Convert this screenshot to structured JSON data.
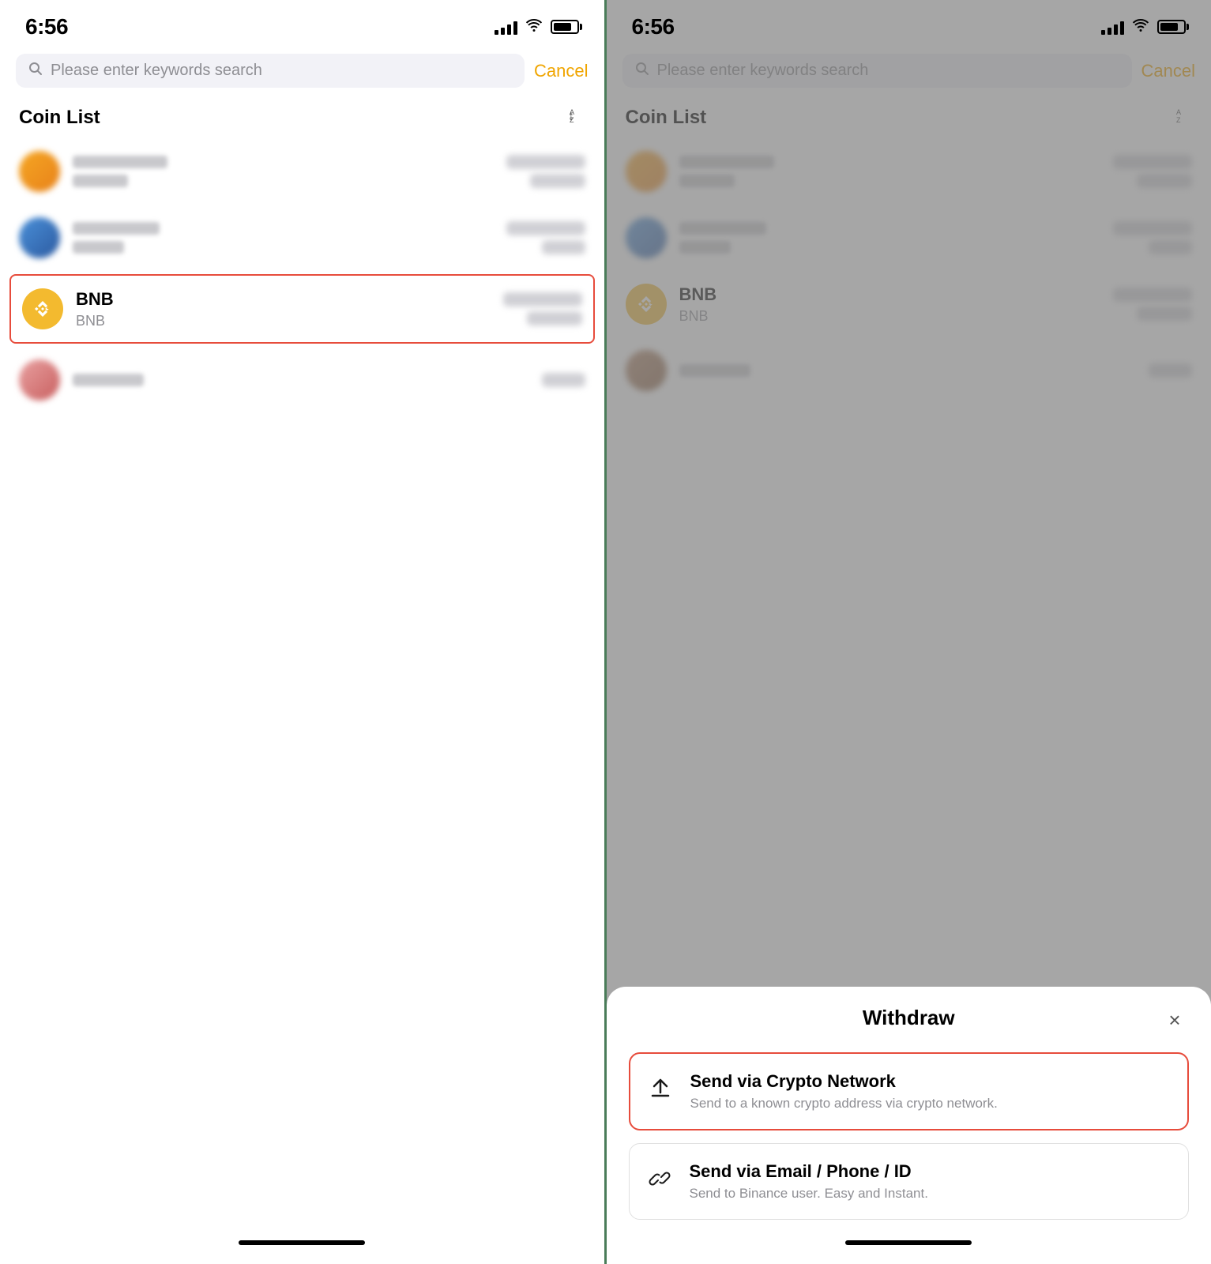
{
  "left": {
    "status": {
      "time": "6:56"
    },
    "search": {
      "placeholder": "Please enter keywords search",
      "cancel_label": "Cancel"
    },
    "coin_list": {
      "title": "Coin List",
      "sort_label": "A-Z sort"
    },
    "bnb": {
      "name": "BNB",
      "symbol": "BNB"
    }
  },
  "right": {
    "status": {
      "time": "6:56"
    },
    "search": {
      "placeholder": "Please enter keywords search",
      "cancel_label": "Cancel"
    },
    "coin_list": {
      "title": "Coin List",
      "sort_label": "A-Z sort"
    },
    "bnb": {
      "name": "BNB",
      "symbol": "BNB"
    },
    "modal": {
      "title": "Withdraw",
      "close_label": "×",
      "option1": {
        "title": "Send via Crypto Network",
        "description": "Send to a known crypto address via crypto network."
      },
      "option2": {
        "title": "Send via Email / Phone / ID",
        "description": "Send to Binance user. Easy and Instant."
      }
    }
  }
}
